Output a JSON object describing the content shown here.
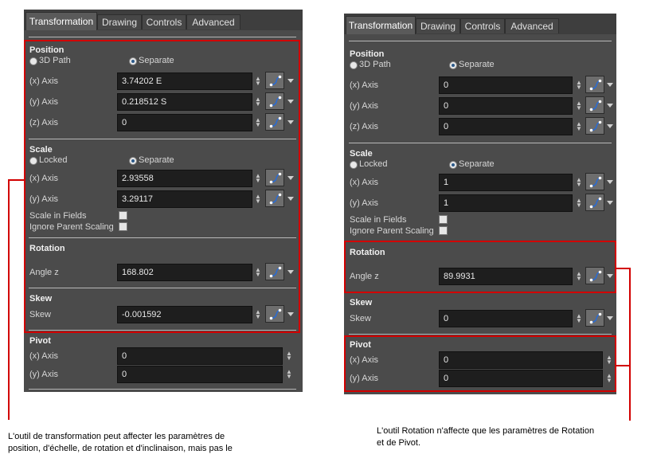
{
  "tabs": [
    "Transformation",
    "Drawing",
    "Controls",
    "Advanced"
  ],
  "labels": {
    "position": "Position",
    "path_3d": "3D Path",
    "separate": "Separate",
    "x_axis": "(x) Axis",
    "y_axis": "(y) Axis",
    "z_axis": "(z) Axis",
    "scale": "Scale",
    "locked": "Locked",
    "scale_in_fields": "Scale in Fields",
    "ignore_parent_scaling": "Ignore Parent Scaling",
    "rotation": "Rotation",
    "angle_z": "Angle z",
    "skew_header": "Skew",
    "skew_label": "Skew",
    "pivot": "Pivot"
  },
  "left_panel": {
    "position": {
      "x": "3.74202 E",
      "y": "0.218512 S",
      "z": "0"
    },
    "scale": {
      "x": "2.93558",
      "y": "3.29117"
    },
    "rotation_angle": "168.802",
    "skew": "-0.001592",
    "pivot": {
      "x": "0",
      "y": "0"
    }
  },
  "right_panel": {
    "position": {
      "x": "0",
      "y": "0",
      "z": "0"
    },
    "scale": {
      "x": "1",
      "y": "1"
    },
    "rotation_angle": "89.9931",
    "skew": "0",
    "pivot": {
      "x": "0",
      "y": "0"
    }
  },
  "captions": {
    "left_line1": "L'outil de transformation peut affecter les paramètres de",
    "left_line2": "position, d'échelle, de rotation et d'inclinaison, mais pas le",
    "right_line1": "L'outil Rotation n'affecte que les paramètres de Rotation",
    "right_line2": "et de Pivot."
  },
  "colors": {
    "annotation_red": "#d20000",
    "panel_bg": "#4b4b4b"
  }
}
